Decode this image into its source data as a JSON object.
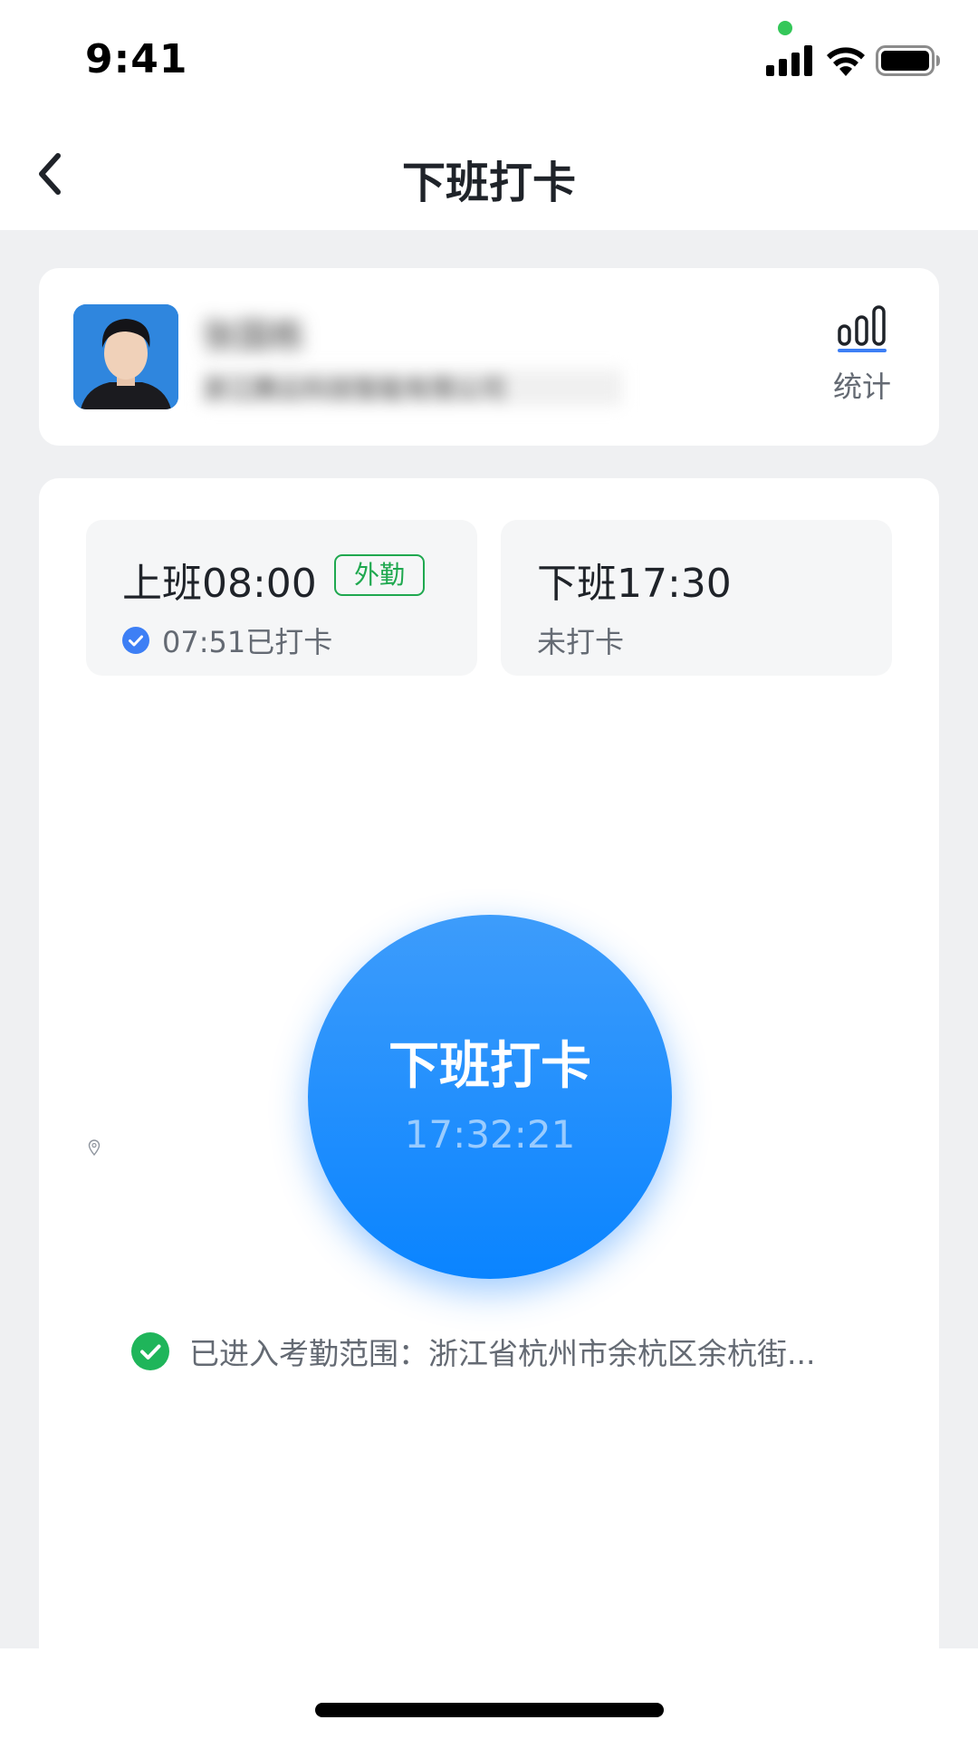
{
  "status_bar": {
    "time": "9:41",
    "icons": [
      "signal-icon",
      "wifi-icon",
      "battery-icon"
    ]
  },
  "nav": {
    "back_icon": "chevron-left-icon",
    "title": "下班打卡"
  },
  "profile": {
    "name": "张国栋",
    "company": "浙江腾云科技智能有限公司",
    "stats_icon": "bar-chart-icon",
    "stats_label": "统计"
  },
  "shifts": [
    {
      "title": "上班08:00",
      "badge": "外勤",
      "status": "07:51已打卡",
      "status_icon": "check-circle-icon"
    },
    {
      "title": "下班17:30",
      "status": "未打卡"
    }
  ],
  "punch": {
    "label": "下班打卡",
    "time": "17:32:21"
  },
  "range": {
    "icon": "check-circle-icon",
    "text": "已进入考勤范围：浙江省杭州市余杭区余杭街..."
  },
  "colors": {
    "accent": "#0a84ff",
    "success": "#1fb55a",
    "badge_green": "#1fa84f",
    "check_blue": "#3d7ff5",
    "background": "#eff0f2"
  }
}
